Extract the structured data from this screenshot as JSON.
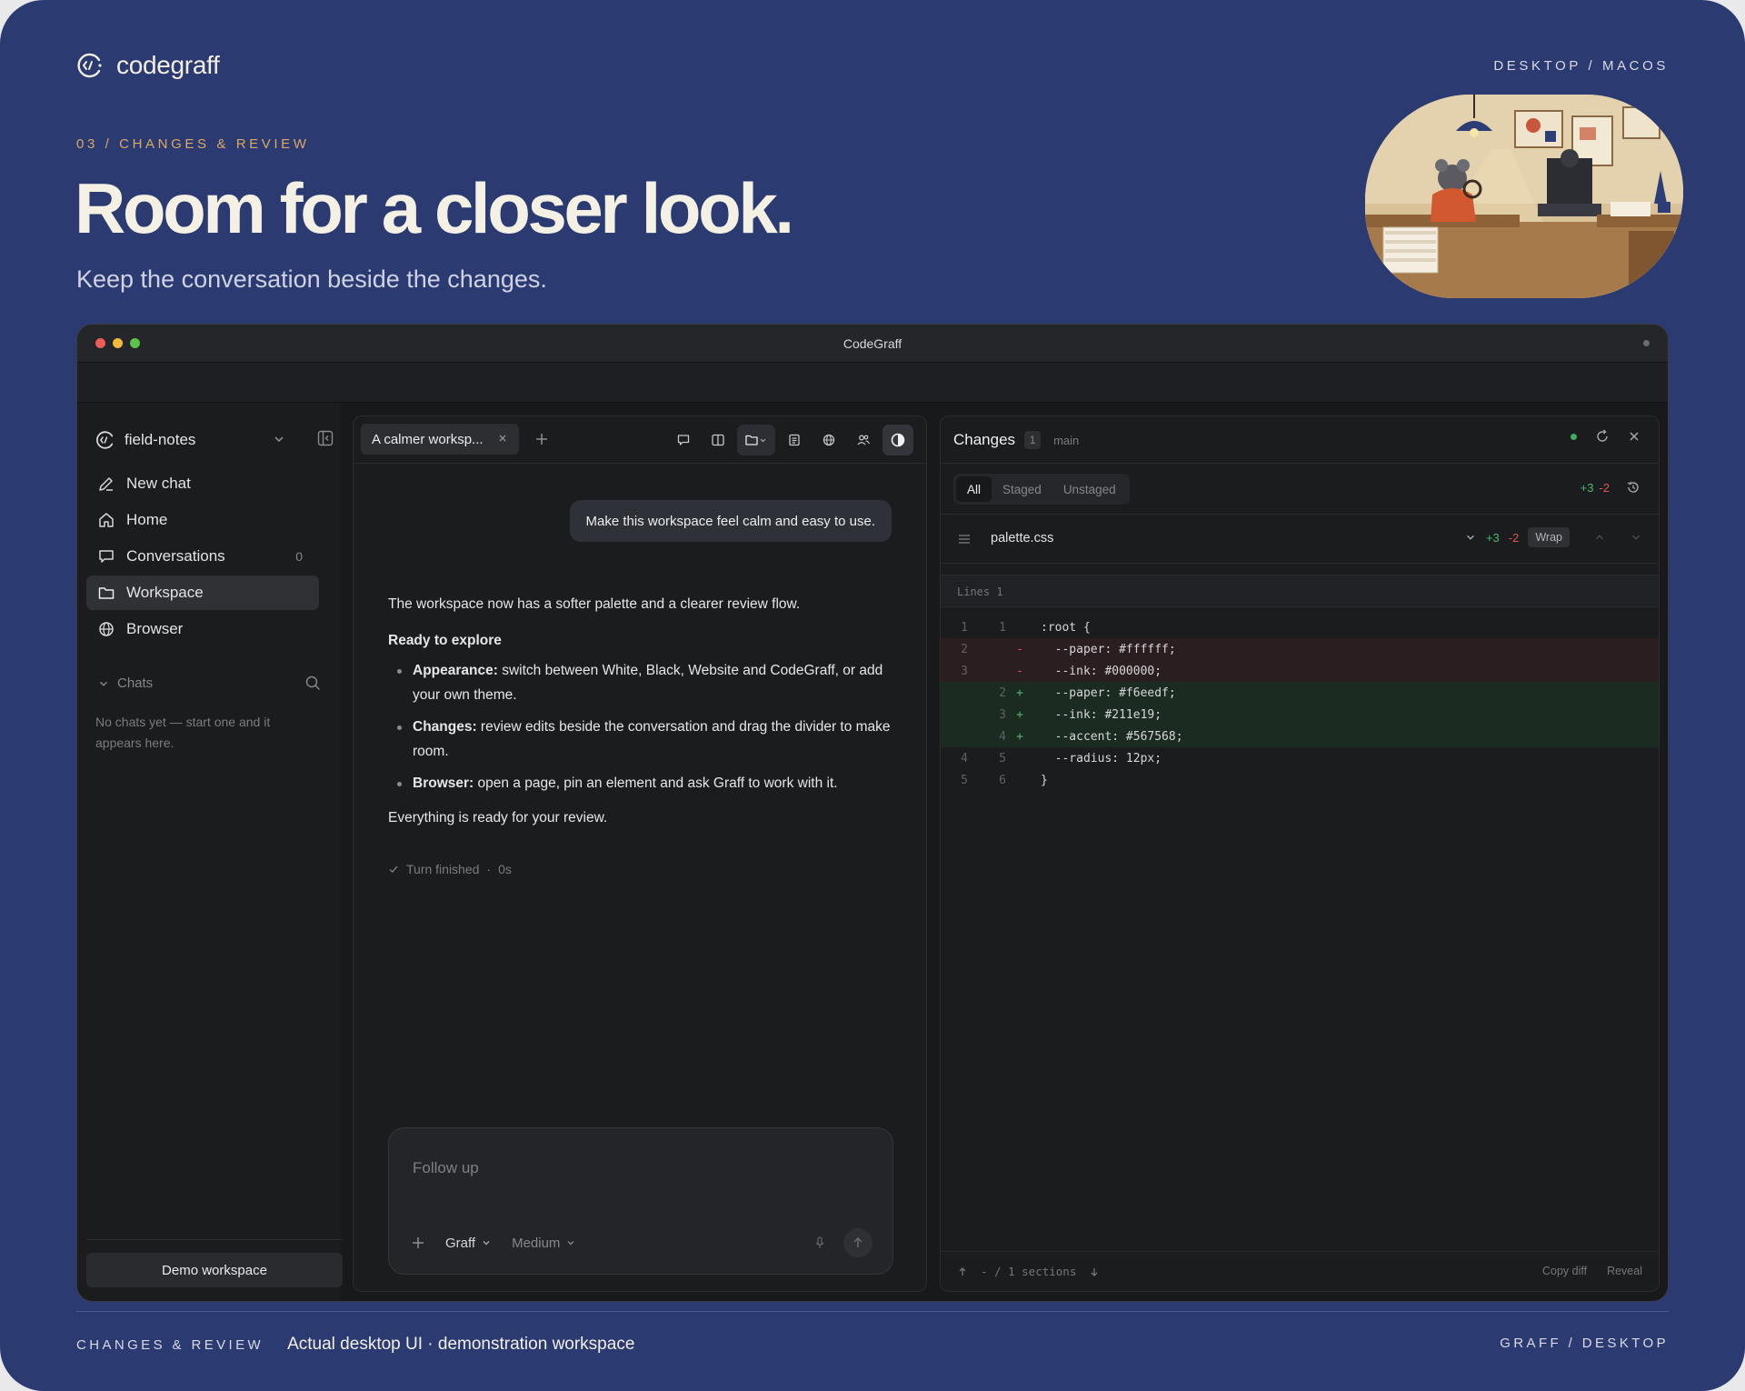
{
  "brand": {
    "name": "codegraff",
    "platform": "DESKTOP / MACOS"
  },
  "hero": {
    "eyebrow": "03 / CHANGES & REVIEW",
    "headline": "Room for a closer look.",
    "subheadline": "Keep the conversation beside the changes."
  },
  "window": {
    "title": "CodeGraff"
  },
  "sidebar": {
    "project": "field-notes",
    "items": [
      {
        "label": "New chat",
        "icon": "pencil-icon"
      },
      {
        "label": "Home",
        "icon": "home-icon"
      },
      {
        "label": "Conversations",
        "icon": "chat-bubble-icon",
        "count": "0"
      },
      {
        "label": "Workspace",
        "icon": "folder-icon",
        "active": true
      },
      {
        "label": "Browser",
        "icon": "globe-icon"
      }
    ],
    "chats_label": "Chats",
    "chats_empty": "No chats yet — start one and it appears here.",
    "demo_button": "Demo workspace"
  },
  "chat": {
    "tab_label": "A calmer worksp...",
    "user_message": "Make this workspace feel calm and easy to use.",
    "reply_intro": "The workspace now has a softer palette and a clearer review flow.",
    "reply_heading": "Ready to explore",
    "bullets": [
      {
        "term": "Appearance:",
        "text": " switch between White, Black, Website and CodeGraff, or add your own theme."
      },
      {
        "term": "Changes:",
        "text": " review edits beside the conversation and drag the divider to make room."
      },
      {
        "term": "Browser:",
        "text": " open a page, pin an element and ask Graff to work with it."
      }
    ],
    "reply_outro": "Everything is ready for your review.",
    "turn_status": "Turn finished",
    "turn_time": "0s",
    "composer_placeholder": "Follow up",
    "model": "Graff",
    "effort": "Medium"
  },
  "changes": {
    "title": "Changes",
    "count": "1",
    "branch": "main",
    "filters": [
      "All",
      "Staged",
      "Unstaged"
    ],
    "active_filter": "All",
    "additions": "+3",
    "deletions": "-2",
    "file": "palette.css",
    "wrap_label": "Wrap",
    "lines_label": "Lines 1",
    "diff": [
      {
        "old": "1",
        "new": "1",
        "type": "ctx",
        "sign": "",
        "text": ":root {"
      },
      {
        "old": "2",
        "new": "",
        "type": "del",
        "sign": "-",
        "text": "  --paper: #ffffff;"
      },
      {
        "old": "3",
        "new": "",
        "type": "del",
        "sign": "-",
        "text": "  --ink: #000000;"
      },
      {
        "old": "",
        "new": "2",
        "type": "add",
        "sign": "+",
        "text": "  --paper: #f6eedf;"
      },
      {
        "old": "",
        "new": "3",
        "type": "add",
        "sign": "+",
        "text": "  --ink: #211e19;"
      },
      {
        "old": "",
        "new": "4",
        "type": "add",
        "sign": "+",
        "text": "  --accent: #567568;"
      },
      {
        "old": "4",
        "new": "5",
        "type": "ctx",
        "sign": "",
        "text": "  --radius: 12px;"
      },
      {
        "old": "5",
        "new": "6",
        "type": "ctx",
        "sign": "",
        "text": "}"
      }
    ],
    "sections": "- / 1 sections",
    "copy_diff": "Copy diff",
    "reveal": "Reveal"
  },
  "footer": {
    "kicker": "CHANGES & REVIEW",
    "description": "Actual desktop UI · demonstration workspace",
    "right": "GRAFF / DESKTOP"
  },
  "colors": {
    "page_bg": "#2b3b72",
    "accent_eyebrow": "#dba863",
    "window_bg": "#18191b",
    "diff_add": "#49b86b",
    "diff_del": "#e0525a",
    "status_green": "#3fae62"
  }
}
